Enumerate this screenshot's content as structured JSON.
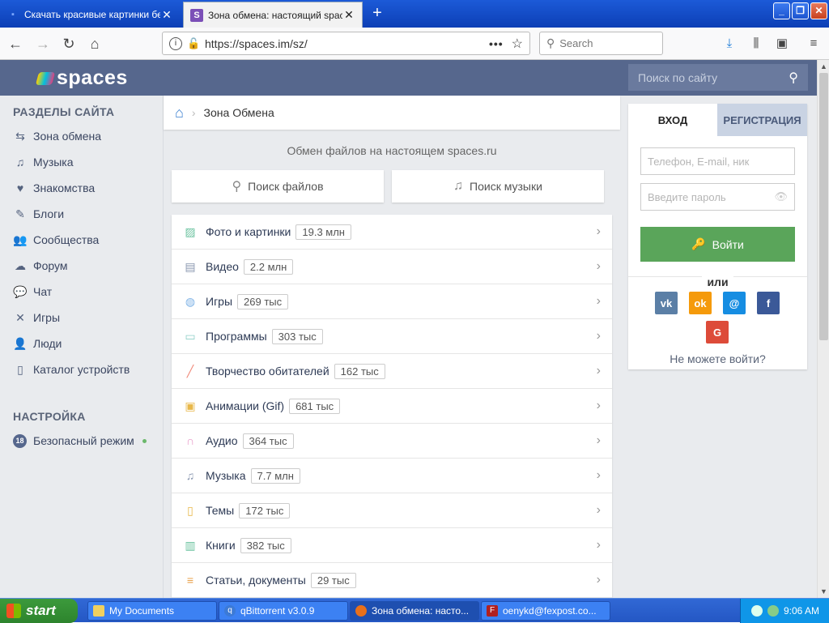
{
  "browser": {
    "tabs": [
      {
        "title": "Скачать красивые картинки бе",
        "active": false
      },
      {
        "title": "Зона обмена: настоящий spaces",
        "active": true
      }
    ],
    "url": "https://spaces.im/sz/",
    "search_placeholder": "Search"
  },
  "site": {
    "logo_text": "spaces",
    "search_placeholder": "Поиск по сайту"
  },
  "sidebar": {
    "sections_title": "РАЗДЕЛЫ САЙТА",
    "items": [
      {
        "label": "Зона обмена",
        "icon": "exchange-icon"
      },
      {
        "label": "Музыка",
        "icon": "music-note-icon"
      },
      {
        "label": "Знакомства",
        "icon": "heart-icon"
      },
      {
        "label": "Блоги",
        "icon": "pen-icon"
      },
      {
        "label": "Сообщества",
        "icon": "group-icon"
      },
      {
        "label": "Форум",
        "icon": "forum-icon"
      },
      {
        "label": "Чат",
        "icon": "chat-icon"
      },
      {
        "label": "Игры",
        "icon": "swords-icon"
      },
      {
        "label": "Люди",
        "icon": "people-icon"
      },
      {
        "label": "Каталог устройств",
        "icon": "phone-icon"
      }
    ],
    "settings_title": "НАСТРОЙКА",
    "safe_mode": {
      "badge": "18",
      "label": "Безопасный режим"
    }
  },
  "main": {
    "breadcrumb": "Зона Обмена",
    "subtitle": "Обмен файлов на настоящем spaces.ru",
    "search_files": "Поиск файлов",
    "search_music": "Поиск музыки",
    "categories": [
      {
        "name": "Фото и картинки",
        "count": "19.3 млн",
        "icon": "image-icon",
        "color": "#6cc3a0"
      },
      {
        "name": "Видео",
        "count": "2.2 млн",
        "icon": "film-icon",
        "color": "#8a97b0"
      },
      {
        "name": "Игры",
        "count": "269 тыс",
        "icon": "gamepad-icon",
        "color": "#7fb3e6"
      },
      {
        "name": "Программы",
        "count": "303 тыс",
        "icon": "monitor-icon",
        "color": "#8fd0c8"
      },
      {
        "name": "Творчество обитателей",
        "count": "162 тыс",
        "icon": "brush-icon",
        "color": "#f08a7a"
      },
      {
        "name": "Анимации (Gif)",
        "count": "681 тыс",
        "icon": "gif-icon",
        "color": "#e8b84a"
      },
      {
        "name": "Аудио",
        "count": "364 тыс",
        "icon": "headphones-icon",
        "color": "#e89ac8"
      },
      {
        "name": "Музыка",
        "count": "7.7 млн",
        "icon": "music-icon",
        "color": "#8a97b0"
      },
      {
        "name": "Темы",
        "count": "172 тыс",
        "icon": "phone-theme-icon",
        "color": "#e8b84a"
      },
      {
        "name": "Книги",
        "count": "382 тыс",
        "icon": "book-icon",
        "color": "#6cc3a0"
      },
      {
        "name": "Статьи, документы",
        "count": "29 тыс",
        "icon": "document-icon",
        "color": "#e8a04a"
      }
    ]
  },
  "login": {
    "tab_login": "ВХОД",
    "tab_register": "РЕГИСТРАЦИЯ",
    "login_placeholder": "Телефон, E-mail, ник",
    "password_placeholder": "Введите пароль",
    "submit": "Войти",
    "or": "или",
    "social": [
      {
        "label": "vk",
        "icon": "vk-icon",
        "color": "#5b7fa6"
      },
      {
        "label": "ok",
        "icon": "odnoklassniki-icon",
        "color": "#f59a0b"
      },
      {
        "label": "@",
        "icon": "mailru-icon",
        "color": "#168de2"
      },
      {
        "label": "f",
        "icon": "facebook-icon",
        "color": "#3b5998"
      },
      {
        "label": "G",
        "icon": "google-icon",
        "color": "#dd4b39"
      }
    ],
    "cant_login": "Не можете войти?"
  },
  "taskbar": {
    "start": "start",
    "buttons": [
      {
        "label": "My Documents",
        "icon": "folder-icon"
      },
      {
        "label": "qBittorrent v3.0.9",
        "icon": "qbittorrent-icon"
      },
      {
        "label": "Зона обмена: насто...",
        "icon": "firefox-icon"
      },
      {
        "label": "oenykd@fexpost.co...",
        "icon": "filezilla-icon"
      }
    ],
    "clock": "9:06 AM"
  }
}
